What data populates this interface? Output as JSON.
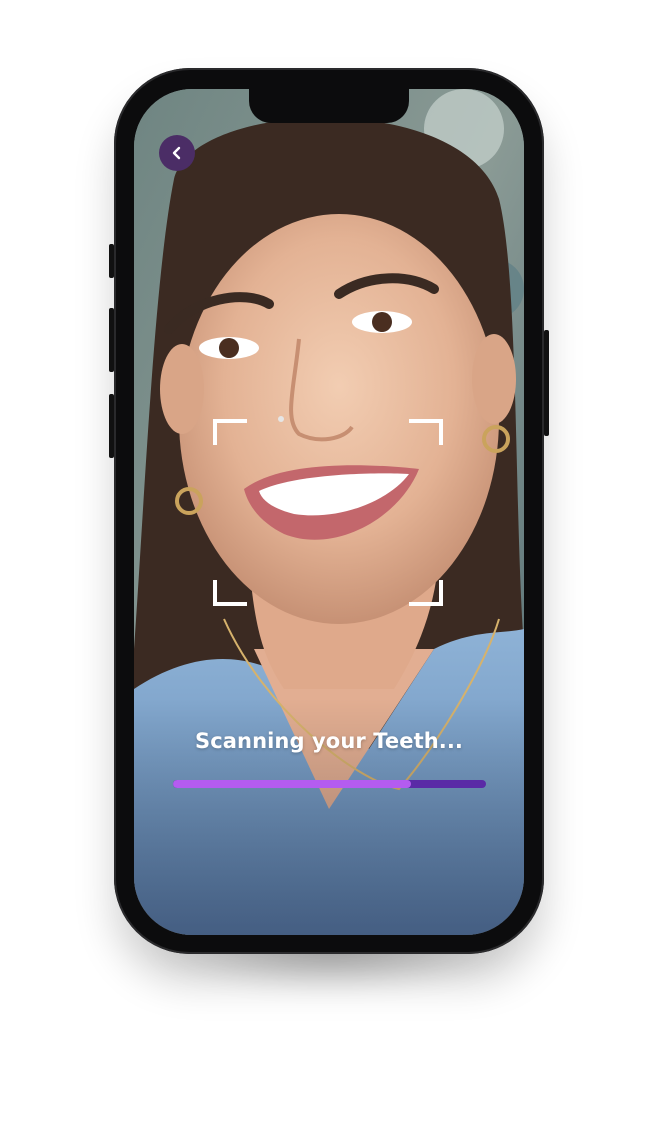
{
  "screen": {
    "back_button": {
      "icon": "chevron-left-icon"
    },
    "scan_label": "Scanning your Teeth...",
    "progress": {
      "fraction": 0.76
    }
  },
  "colors": {
    "accent_fill": "#b45cf0",
    "accent_track": "#5a2aa6",
    "back_button_bg": "#4b2d66",
    "frame": "#ffffff"
  }
}
